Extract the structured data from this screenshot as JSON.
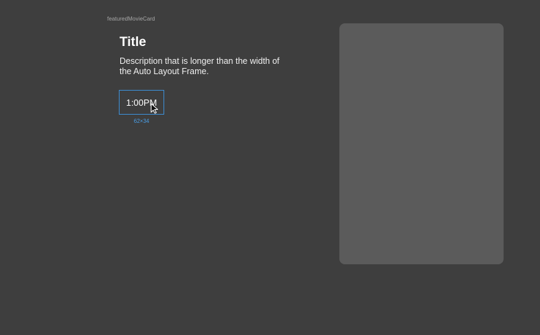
{
  "frame": {
    "label": "featuredMovieCard"
  },
  "card": {
    "title": "Title",
    "description": "Description that is longer than the width of the Auto Layout Frame.",
    "time_label": "1:00PM",
    "selection_size": "62×34"
  },
  "poster": {
    "color": "#5b5b5b"
  },
  "icons": {
    "cursor": "mouse-pointer-icon"
  },
  "colors": {
    "background": "#3e3e3e",
    "selection": "#3d8fd6"
  }
}
